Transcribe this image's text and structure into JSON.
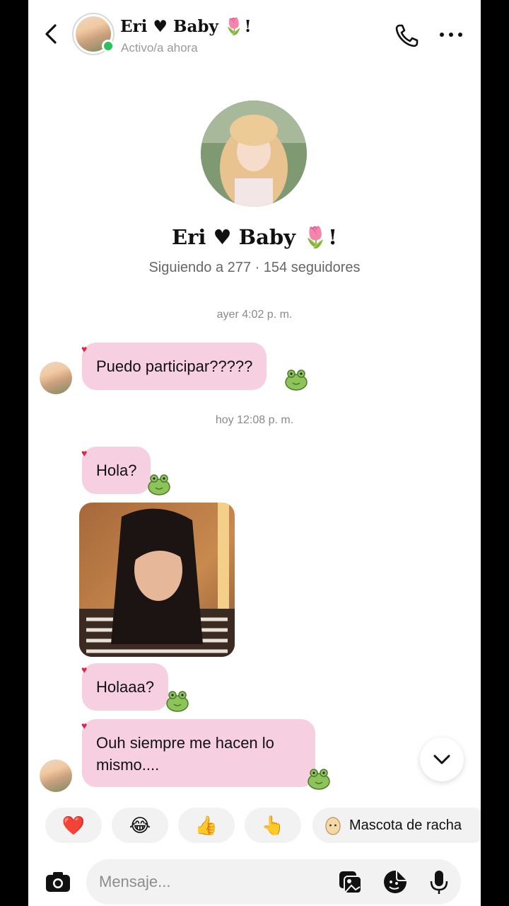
{
  "header": {
    "name": "Eri ♥ Baby 🌷!",
    "status": "Activo/a ahora"
  },
  "profile": {
    "name": "Eri ♥ Baby 🌷!",
    "stats": "Siguiendo a 277 · 154 seguidores"
  },
  "timestamps": {
    "yesterday": "ayer 4:02 p. m.",
    "today": "hoy 12:08 p. m."
  },
  "messages": [
    {
      "text": "Puedo participar?????",
      "reaction": "♥"
    },
    {
      "text": "Hola?",
      "reaction": "♥"
    },
    {
      "text": "Holaaa?",
      "reaction": "♥"
    },
    {
      "text": "Ouh siempre me hacen lo mismo....",
      "reaction": "♥"
    }
  ],
  "quick_reactions": {
    "items": [
      "❤️",
      "😂",
      "👍",
      "👆"
    ],
    "mascot_label": "Mascota de racha"
  },
  "composer": {
    "placeholder": "Mensaje..."
  },
  "colors": {
    "bubble": "#f6cfe1",
    "online": "#2bc05c",
    "heart": "#e0244b"
  }
}
